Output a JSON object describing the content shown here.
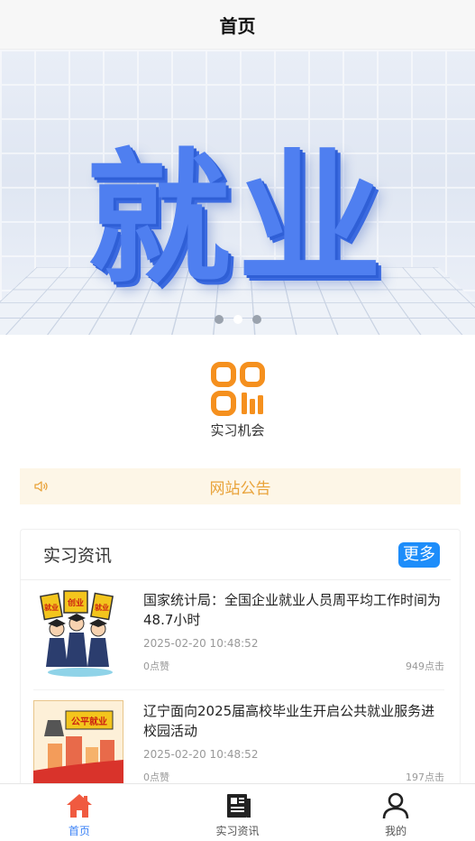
{
  "navbar": {
    "title": "首页"
  },
  "banner": {
    "headline": "就业",
    "slide_count": 3,
    "active_slide": 2
  },
  "categories": [
    {
      "label": "实习机会",
      "icon": "qr-code-icon"
    }
  ],
  "notice": {
    "icon": "speaker-icon",
    "text": "网站公告"
  },
  "news": {
    "title": "实习资讯",
    "more_label": "更多",
    "items": [
      {
        "title": "国家统计局：全国企业就业人员周平均工作时间为48.7小时",
        "time": "2025-02-20 10:48:52",
        "likes": "0点赞",
        "clicks": "949点击",
        "thumb_sign_labels": [
          "就业",
          "创业",
          "就业"
        ]
      },
      {
        "title": "辽宁面向2025届高校毕业生开启公共就业服务进校园活动",
        "time": "2025-02-20 10:48:52",
        "likes": "0点赞",
        "clicks": "197点击",
        "thumb_sign_labels": [
          "公平就业"
        ]
      }
    ]
  },
  "tabbar": {
    "items": [
      {
        "label": "首页",
        "icon": "home-icon",
        "active": true
      },
      {
        "label": "实习资讯",
        "icon": "news-icon",
        "active": false
      },
      {
        "label": "我的",
        "icon": "user-icon",
        "active": false
      }
    ]
  },
  "colors": {
    "accent": "#3b82f6",
    "home_icon": "#f05a40",
    "notice_bg": "#fdf6e7",
    "notice_text": "#e9a33a",
    "more_button": "#1d8dfa",
    "category_icon": "#f5901e"
  }
}
